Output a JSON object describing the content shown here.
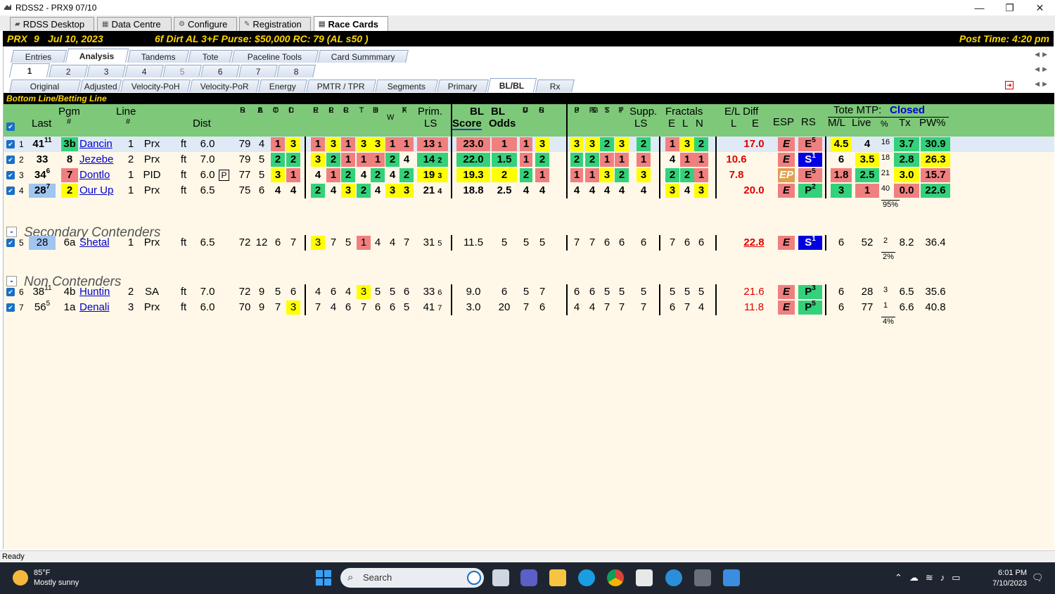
{
  "window": {
    "title": "RDSS2 - PRX9  07/10",
    "controls": [
      "—",
      "❐",
      "✕"
    ]
  },
  "top_tabs": [
    {
      "label": "RDSS Desktop",
      "icon": "desktop-icon"
    },
    {
      "label": "Data Centre",
      "icon": "data-icon"
    },
    {
      "label": "Configure",
      "icon": "gear-icon"
    },
    {
      "label": "Registration",
      "icon": "registration-icon"
    },
    {
      "label": "Race Cards",
      "icon": "racecard-icon",
      "active": true
    }
  ],
  "race": {
    "track": "PRX",
    "race_no": "9",
    "date": "Jul 10, 2023",
    "conditions": "6f  Dirt  AL  3+F  Purse: $50,000  RC: 79  (AL s50 )",
    "post_time": "Post Time: 4:20 pm"
  },
  "view_tabs": [
    "Entries",
    "Analysis",
    "Tandems",
    "Tote",
    "Paceline Tools",
    "Card Summmary"
  ],
  "race_tabs": [
    "1",
    "2",
    "3",
    "4",
    "5",
    "6",
    "7",
    "8"
  ],
  "sub_tabs": [
    "Original",
    "Adjusted",
    "Velocity-PoH",
    "Velocity-PoR",
    "Energy",
    "PMTR / TPR",
    "Segments",
    "Primary",
    "BL/BL",
    "Rx"
  ],
  "section_title": "Bottom Line/Betting Line",
  "headers": {
    "pgm": "Pgm",
    "pgm_hash": "#",
    "last": "Last",
    "line": "Line",
    "line_hash": "#",
    "dist": "Dist",
    "prim": "Prim.",
    "ls": "LS",
    "bl1": "BL",
    "bl2": "BL",
    "score": "Score",
    "odds": "Odds",
    "supp": "Supp.",
    "supp_ls": "LS",
    "fractals": "Fractals",
    "frac_e": "E",
    "frac_l": "L",
    "frac_n": "N",
    "el_diff": "E/L Diff",
    "el_l": "L",
    "el_e": "E",
    "esp": "ESP",
    "rs": "RS",
    "tote_mtp": "Tote MTP:",
    "tote_status": "Closed",
    "ml": "M/L",
    "live": "Live",
    "pct": "%",
    "tx": "Tx",
    "pw": "PW%",
    "stack_sr": [
      "S",
      "R"
    ],
    "stack_bal": [
      "B",
      "A",
      "L"
    ],
    "stack_toc": [
      "T",
      "O",
      "C"
    ],
    "stack_dcl": [
      "D",
      "C",
      "L"
    ],
    "stack_epr": [
      "E",
      "P",
      "R"
    ],
    "stack_lpr": [
      "L",
      "P",
      "R"
    ],
    "stack_cpr": [
      "C",
      "P",
      "R"
    ],
    "stack_tt": [
      "T",
      "T"
    ],
    "stack_hid": [
      "H",
      "I",
      "D"
    ],
    "stack_w": [
      "W"
    ],
    "stack_fx": [
      "F",
      "X"
    ],
    "stack_vdc": [
      "V",
      "D",
      "C"
    ],
    "stack_csr": [
      "C",
      "S",
      "R"
    ],
    "stack_pf3": [
      "P",
      "F",
      "3"
    ],
    "stack_tsf3": [
      "T",
      "S",
      "F3"
    ],
    "stack_ts": [
      "T",
      "S"
    ],
    "stack_tp": [
      "T",
      "P"
    ]
  },
  "groups": [
    "Secondary Contenders",
    "Non Contenders"
  ],
  "horses": [
    {
      "row": "1",
      "last": "41",
      "last_sup": "11",
      "pgm": "3b",
      "name": "Dancin",
      "line": "1",
      "trk": "Prx",
      "surf": "ft",
      "dist": "6.0",
      "dist_p": "",
      "sr": "79",
      "bal": "4",
      "toc": "1",
      "dcl": "3",
      "epr": "1",
      "lpr": "3",
      "cpr": "1",
      "tt": "3",
      "hid": "3",
      "w": "1",
      "fx": "1",
      "prim": "13",
      "prim_r": "1",
      "score": "23.0",
      "odds": "1",
      "vdc": "1",
      "csr": "3",
      "pf3": "3",
      "tsf3": "3",
      "ts": "2",
      "tp": "3",
      "supp": "2",
      "fe": "1",
      "fl": "3",
      "fn": "2",
      "el_l": "",
      "el_e": "17.0",
      "esp": "E",
      "rs": "E",
      "rs_sup": "5",
      "ml": "4.5",
      "live": "4",
      "pct": "16",
      "tx": "3.7",
      "pw": "30.9",
      "sub": ""
    },
    {
      "row": "2",
      "last": "33",
      "last_sup": "",
      "pgm": "8",
      "name": "Jezebe",
      "line": "2",
      "trk": "Prx",
      "surf": "ft",
      "dist": "7.0",
      "dist_p": "",
      "sr": "79",
      "bal": "5",
      "toc": "2",
      "dcl": "2",
      "epr": "3",
      "lpr": "2",
      "cpr": "1",
      "tt": "1",
      "hid": "1",
      "w": "2",
      "fx": "4",
      "prim": "14",
      "prim_r": "2",
      "score": "22.0",
      "odds": "1.5",
      "vdc": "1",
      "csr": "2",
      "pf3": "2",
      "tsf3": "2",
      "ts": "1",
      "tp": "1",
      "supp": "1",
      "fe": "4",
      "fl": "1",
      "fn": "1",
      "el_l": "10.6",
      "el_e": "",
      "esp": "E",
      "rs": "S",
      "rs_sup": "1",
      "ml": "6",
      "live": "3.5",
      "pct": "18",
      "tx": "2.8",
      "pw": "26.3",
      "sub": ""
    },
    {
      "row": "3",
      "last": "34",
      "last_sup": "6",
      "pgm": "7",
      "name": "Dontlo",
      "line": "1",
      "trk": "PID",
      "surf": "ft",
      "dist": "6.0",
      "dist_p": "P",
      "sr": "77",
      "bal": "5",
      "toc": "3",
      "dcl": "1",
      "epr": "4",
      "lpr": "1",
      "cpr": "2",
      "tt": "4",
      "hid": "2",
      "w": "4",
      "fx": "2",
      "prim": "19",
      "prim_r": "3",
      "score": "19.3",
      "odds": "2",
      "vdc": "2",
      "csr": "1",
      "pf3": "1",
      "tsf3": "1",
      "ts": "3",
      "tp": "2",
      "supp": "3",
      "fe": "2",
      "fl": "2",
      "fn": "1",
      "el_l": "7.8",
      "el_e": "",
      "esp": "EP",
      "rs": "E",
      "rs_sup": "5",
      "ml": "1.8",
      "live": "2.5",
      "pct": "21",
      "tx": "3.0",
      "pw": "15.7",
      "sub": ""
    },
    {
      "row": "4",
      "last": "28",
      "last_sup": "7",
      "pgm": "2",
      "name": "Our Up",
      "line": "1",
      "trk": "Prx",
      "surf": "ft",
      "dist": "6.5",
      "dist_p": "",
      "sr": "75",
      "bal": "6",
      "toc": "4",
      "dcl": "4",
      "epr": "2",
      "lpr": "4",
      "cpr": "3",
      "tt": "2",
      "hid": "4",
      "w": "3",
      "fx": "3",
      "prim": "21",
      "prim_r": "4",
      "score": "18.8",
      "odds": "2.5",
      "vdc": "4",
      "csr": "4",
      "pf3": "4",
      "tsf3": "4",
      "ts": "4",
      "tp": "4",
      "supp": "4",
      "fe": "3",
      "fl": "4",
      "fn": "3",
      "el_l": "",
      "el_e": "20.0",
      "esp": "E",
      "rs": "P",
      "rs_sup": "2",
      "ml": "3",
      "live": "1",
      "pct": "40",
      "tx": "0.0",
      "pw": "22.6",
      "sub": "95%"
    },
    {
      "row": "5",
      "last": "28",
      "last_sup": "",
      "pgm": "6a",
      "name": "Shetal",
      "line": "1",
      "trk": "Prx",
      "surf": "ft",
      "dist": "6.5",
      "dist_p": "",
      "sr": "72",
      "bal": "12",
      "toc": "6",
      "dcl": "7",
      "epr": "3",
      "lpr": "7",
      "cpr": "5",
      "tt": "1",
      "hid": "4",
      "w": "4",
      "fx": "7",
      "prim": "31",
      "prim_r": "5",
      "score": "11.5",
      "odds": "5",
      "vdc": "5",
      "csr": "5",
      "pf3": "7",
      "tsf3": "7",
      "ts": "6",
      "tp": "6",
      "supp": "6",
      "fe": "7",
      "fl": "6",
      "fn": "6",
      "el_l": "",
      "el_e": "22.8",
      "esp": "E",
      "rs": "S",
      "rs_sup": "1",
      "ml": "6",
      "live": "52",
      "pct": "2",
      "tx": "8.2",
      "pw": "36.4",
      "sub": "2%"
    },
    {
      "row": "6",
      "last": "38",
      "last_sup": "11",
      "pgm": "4b",
      "name": "Huntin",
      "line": "2",
      "trk": "SA",
      "surf": "ft",
      "dist": "7.0",
      "dist_p": "",
      "sr": "72",
      "bal": "9",
      "toc": "5",
      "dcl": "6",
      "epr": "4",
      "lpr": "6",
      "cpr": "4",
      "tt": "3",
      "hid": "5",
      "w": "5",
      "fx": "6",
      "prim": "33",
      "prim_r": "6",
      "score": "9.0",
      "odds": "6",
      "vdc": "5",
      "csr": "7",
      "pf3": "6",
      "tsf3": "6",
      "ts": "5",
      "tp": "5",
      "supp": "5",
      "fe": "5",
      "fl": "5",
      "fn": "5",
      "el_l": "",
      "el_e": "21.6",
      "esp": "E",
      "rs": "P",
      "rs_sup": "3",
      "ml": "6",
      "live": "28",
      "pct": "3",
      "tx": "6.5",
      "pw": "35.6",
      "sub": ""
    },
    {
      "row": "7",
      "last": "56",
      "last_sup": "5",
      "pgm": "1a",
      "name": "Denali",
      "line": "3",
      "trk": "Prx",
      "surf": "ft",
      "dist": "6.0",
      "dist_p": "",
      "sr": "70",
      "bal": "9",
      "toc": "7",
      "dcl": "3",
      "epr": "7",
      "lpr": "4",
      "cpr": "6",
      "tt": "7",
      "hid": "6",
      "w": "6",
      "fx": "5",
      "prim": "41",
      "prim_r": "7",
      "score": "3.0",
      "odds": "20",
      "vdc": "7",
      "csr": "6",
      "pf3": "4",
      "tsf3": "4",
      "ts": "7",
      "tp": "7",
      "supp": "7",
      "fe": "6",
      "fl": "7",
      "fn": "4",
      "el_l": "",
      "el_e": "11.8",
      "esp": "E",
      "rs": "P",
      "rs_sup": "5",
      "ml": "6",
      "live": "77",
      "pct": "1",
      "tx": "6.6",
      "pw": "40.8",
      "sub": "4%"
    }
  ],
  "status": "Ready",
  "taskbar": {
    "temp": "85°F",
    "weather": "Mostly sunny",
    "search": "Search",
    "time": "6:01 PM",
    "date": "7/10/2023"
  },
  "colors": {
    "header_green": "#7ec87a",
    "red": "#f08080",
    "yellow": "#ffff00",
    "green": "#33d17a",
    "blue": "#0000e0",
    "grid_bg": "#fff8e8",
    "gold": "#ffd700"
  }
}
